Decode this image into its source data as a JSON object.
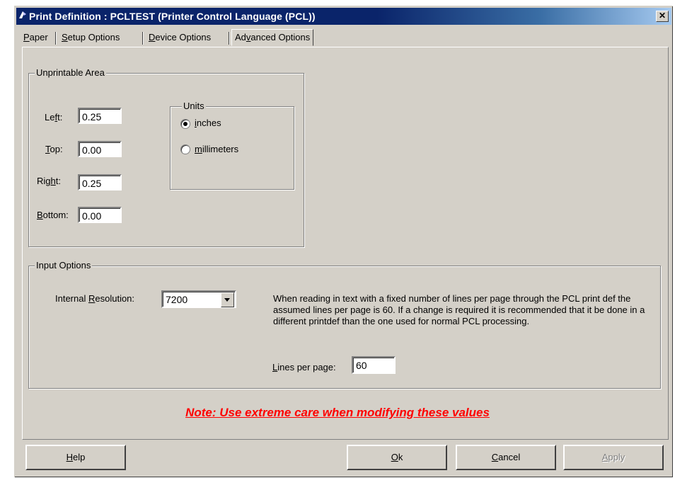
{
  "window": {
    "title": "Print Definition : PCLTEST (Printer Control Language (PCL))",
    "close_glyph": "✕"
  },
  "tabs": [
    {
      "label": "Paper",
      "mnemonic": "P",
      "rest": "aper",
      "selected": false
    },
    {
      "label": "Setup Options",
      "mnemonic": "S",
      "rest": "etup Options",
      "selected": false
    },
    {
      "label": "Device Options",
      "mnemonic": "D",
      "rest": "evice Options",
      "selected": false
    },
    {
      "label": "Advanced Options",
      "pre": "Ad",
      "mnemonic": "v",
      "rest": "anced Options",
      "selected": true
    }
  ],
  "unprintable": {
    "legend": "Unprintable Area",
    "left": {
      "pre": "Le",
      "mnemonic": "f",
      "rest": "t:",
      "value": "0.25"
    },
    "top": {
      "mnemonic": "T",
      "rest": "op:",
      "value": "0.00"
    },
    "right": {
      "pre": "Rig",
      "mnemonic": "h",
      "rest": "t:",
      "value": "0.25"
    },
    "bottom": {
      "mnemonic": "B",
      "rest": "ottom:",
      "value": "0.00"
    },
    "units": {
      "legend": "Units",
      "options": [
        {
          "mnemonic": "i",
          "rest": "nches",
          "checked": true
        },
        {
          "mnemonic": "m",
          "rest": "illimeters",
          "checked": false
        }
      ]
    }
  },
  "input_options": {
    "legend": "Input Options",
    "resolution_label_pre": "Internal ",
    "resolution_label_mnemonic": "R",
    "resolution_label_rest": "esolution:",
    "resolution_value": "7200",
    "description": "When reading in text with a fixed number of lines per page through the PCL print def the assumed lines per page is 60.  If a change is required it is recommended that it be done in a different printdef than the one used for normal PCL processing.",
    "lines_label_mnemonic": "L",
    "lines_label_rest": "ines per page:",
    "lines_value": "60"
  },
  "note": "Note: Use extreme care when modifying these values",
  "buttons": {
    "help": {
      "mnemonic": "H",
      "rest": "elp"
    },
    "ok": {
      "mnemonic": "O",
      "rest": "k"
    },
    "cancel": {
      "mnemonic": "C",
      "rest": "ancel"
    },
    "apply": {
      "mnemonic": "A",
      "rest": "pply"
    }
  },
  "colors": {
    "face": "#d4d0c8",
    "title_bar": "#0a246a",
    "note": "#ff0000"
  },
  "icons": {
    "title": "printer-app-icon"
  }
}
